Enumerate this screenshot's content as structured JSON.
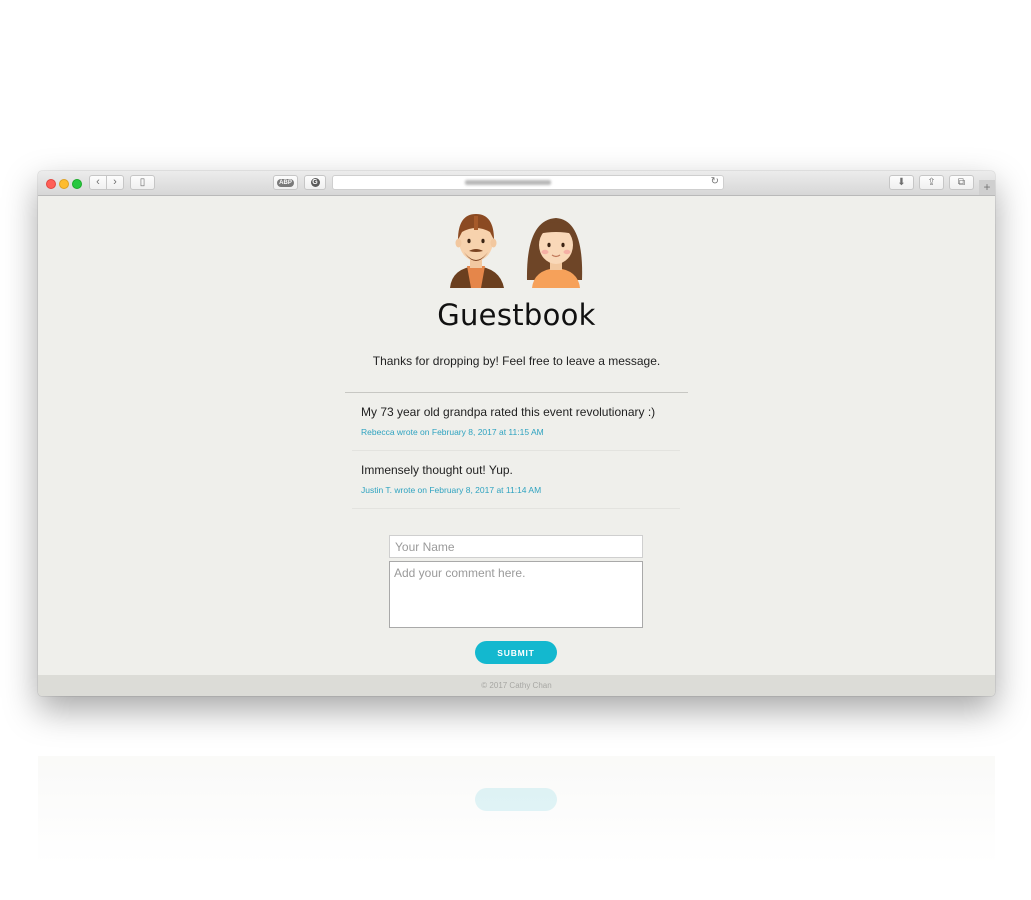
{
  "browser": {
    "url_text": "",
    "controls": {
      "back_icon": "‹",
      "forward_icon": "›",
      "sidebar_icon": "▯",
      "ext1_label": "ABP",
      "ext2_icon": "G",
      "reload_icon": "↻",
      "download_icon": "⬇",
      "share_icon": "⇪",
      "tabs_icon": "⧉",
      "new_tab_icon": "+"
    }
  },
  "page": {
    "title": "Guestbook",
    "subtitle": "Thanks for dropping by! Feel free to leave a message."
  },
  "entries": [
    {
      "message": "My 73 year old grandpa rated this event revolutionary :)",
      "meta": "Rebecca wrote on February 8, 2017 at 11:15 AM"
    },
    {
      "message": "Immensely thought out! Yup.",
      "meta": "Justin T. wrote on February 8, 2017 at 11:14 AM"
    }
  ],
  "form": {
    "name_placeholder": "Your Name",
    "comment_placeholder": "Add your comment here.",
    "submit_label": "SUBMIT"
  },
  "footer": {
    "text": "© 2017 Cathy Chan"
  },
  "colors": {
    "accent": "#13b8cf",
    "meta_link": "#2fa3c0",
    "page_bg": "#efefeb",
    "footer_bg": "#dcdcd7"
  }
}
